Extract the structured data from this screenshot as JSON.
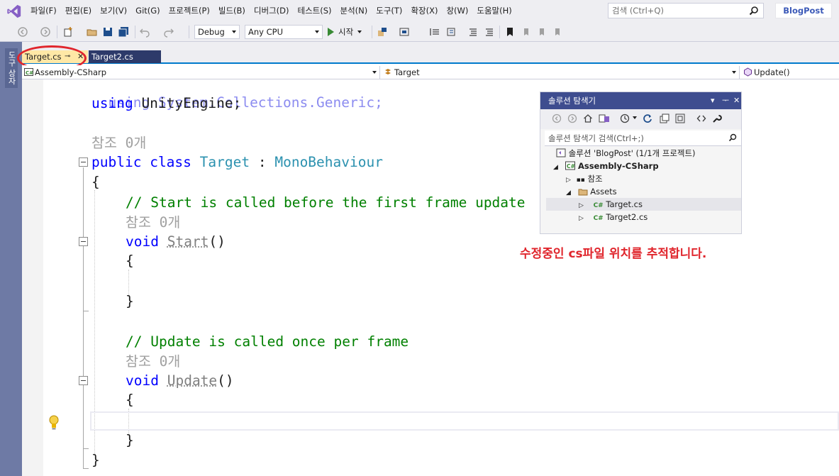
{
  "menu": {
    "items": [
      "파일(F)",
      "편집(E)",
      "보기(V)",
      "Git(G)",
      "프로젝트(P)",
      "빌드(B)",
      "디버그(D)",
      "테스트(S)",
      "분석(N)",
      "도구(T)",
      "확장(X)",
      "창(W)",
      "도움말(H)"
    ],
    "search_placeholder": "검색 (Ctrl+Q)",
    "project_name": "BlogPost"
  },
  "toolbar": {
    "config": "Debug",
    "platform": "Any CPU",
    "start_label": "시작"
  },
  "left_strip": {
    "toolbox_label": "도구 상자"
  },
  "tabs": [
    {
      "label": "Target.cs",
      "active": true
    },
    {
      "label": "Target2.cs",
      "active": false
    }
  ],
  "navbar": {
    "project": "Assembly-CSharp",
    "class": "Target",
    "member": "Update()"
  },
  "code": {
    "line_using1": "using System.Collections.Generic;",
    "line_using2_kw": "using",
    "line_using2_rest": " UnityEngine;",
    "ref_label": "참조 0개",
    "class_kw1": "public",
    "class_kw2": "class",
    "class_name": "Target",
    "class_colon": " : ",
    "base_class": "MonoBehaviour",
    "brace_open": "{",
    "brace_close": "}",
    "comment_start": "// Start is called before the first frame update",
    "void_kw": "void",
    "start_name": "Start",
    "parens": "()",
    "comment_update": "// Update is called once per frame",
    "update_name": "Update"
  },
  "solution_explorer": {
    "title": "솔루션 탐색기",
    "search_placeholder": "솔루션 탐색기 검색(Ctrl+;)",
    "tree": {
      "solution": "솔루션 'BlogPost' (1/1개 프로젝트)",
      "project": "Assembly-CSharp",
      "references": "참조",
      "assets": "Assets",
      "file1": "Target.cs",
      "file2": "Target2.cs"
    }
  },
  "caption": "수정중인 cs파일 위치를 추적합니다.",
  "colors": {
    "accent": "#007acc",
    "annotation_red": "#e0252c",
    "explorer_title": "#3e4d8f",
    "active_tab": "#ffe8a6",
    "inactive_tab": "#2d3a6a"
  }
}
